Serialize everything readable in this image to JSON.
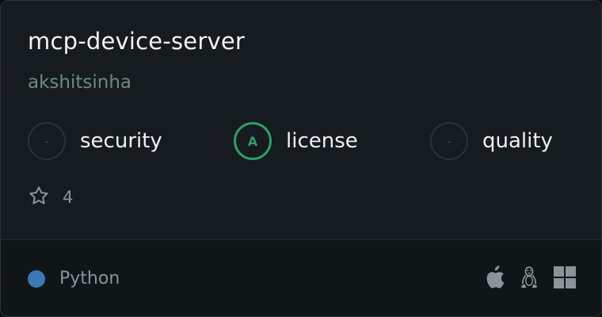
{
  "server": {
    "name": "mcp-device-server",
    "author": "akshitsinha"
  },
  "badges": [
    {
      "grade": "-",
      "label": "security",
      "active": false
    },
    {
      "grade": "A",
      "label": "license",
      "active": true
    },
    {
      "grade": "-",
      "label": "quality",
      "active": false
    }
  ],
  "stars": {
    "count": "4",
    "icon": "star-outline-icon"
  },
  "footer": {
    "language": "Python",
    "language_color": "#3d79b4",
    "platforms": [
      "apple-icon",
      "linux-icon",
      "windows-icon"
    ]
  },
  "colors": {
    "grade_a": "#2e9d67",
    "card_bg": "#151b1e"
  }
}
